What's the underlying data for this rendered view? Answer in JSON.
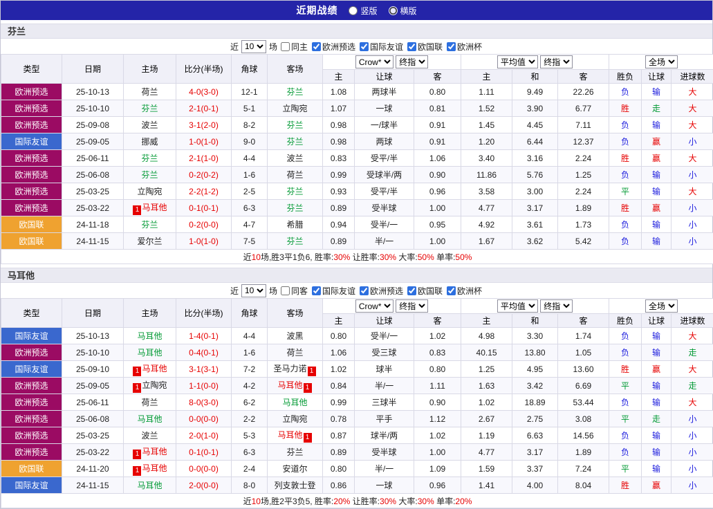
{
  "topbar": {
    "title": "近期战绩",
    "view_options": [
      {
        "label": "竖版",
        "selected": false
      },
      {
        "label": "横版",
        "selected": true
      }
    ]
  },
  "colors": {
    "topbar_bg": "#2424A8",
    "red": "#E60000",
    "blue": "#1C1CDD",
    "green": "#009933",
    "black": "#222222"
  },
  "type_colors": {
    "欧洲预选": "#9B0B63",
    "国际友谊": "#3A68CE",
    "欧国联": "#EFA230"
  },
  "table_headers": [
    "类型",
    "日期",
    "主场",
    "比分(半场)",
    "角球",
    "客场",
    "主",
    "让球",
    "客",
    "主",
    "和",
    "客",
    "胜负",
    "让球",
    "进球数"
  ],
  "sections": [
    {
      "title": "芬兰",
      "filter": {
        "near_label": "近",
        "count": "10",
        "games_label": "场",
        "same_side_label": "同主",
        "same_side_checked": false,
        "competitions": [
          {
            "label": "欧洲预选",
            "checked": true
          },
          {
            "label": "国际友谊",
            "checked": true
          },
          {
            "label": "欧国联",
            "checked": true
          },
          {
            "label": "欧洲杯",
            "checked": true
          }
        ]
      },
      "selects": {
        "odds_company": "Crow*",
        "odds_stage1": "终指",
        "average": "平均值",
        "odds_stage2": "终指",
        "scope": "全场"
      },
      "rows": [
        {
          "type": "欧洲预选",
          "date": "25-10-13",
          "home": {
            "name": "荷兰",
            "color": "black"
          },
          "score": "4-0(3-0)",
          "corner": "12-1",
          "away": {
            "name": "芬兰",
            "color": "green"
          },
          "odds": [
            "1.08",
            "两球半",
            "0.80"
          ],
          "avg": [
            "1.11",
            "9.49",
            "22.26"
          ],
          "results": [
            {
              "t": "负",
              "c": "blue"
            },
            {
              "t": "输",
              "c": "blue"
            },
            {
              "t": "大",
              "c": "red"
            }
          ]
        },
        {
          "type": "欧洲预选",
          "date": "25-10-10",
          "home": {
            "name": "芬兰",
            "color": "green"
          },
          "score": "2-1(0-1)",
          "corner": "5-1",
          "away": {
            "name": "立陶宛",
            "color": "black"
          },
          "odds": [
            "1.07",
            "一球",
            "0.81"
          ],
          "avg": [
            "1.52",
            "3.90",
            "6.77"
          ],
          "results": [
            {
              "t": "胜",
              "c": "red"
            },
            {
              "t": "走",
              "c": "green"
            },
            {
              "t": "大",
              "c": "red"
            }
          ]
        },
        {
          "type": "欧洲预选",
          "date": "25-09-08",
          "home": {
            "name": "波兰",
            "color": "black"
          },
          "score": "3-1(2-0)",
          "corner": "8-2",
          "away": {
            "name": "芬兰",
            "color": "green"
          },
          "odds": [
            "0.98",
            "一/球半",
            "0.91"
          ],
          "avg": [
            "1.45",
            "4.45",
            "7.11"
          ],
          "results": [
            {
              "t": "负",
              "c": "blue"
            },
            {
              "t": "输",
              "c": "blue"
            },
            {
              "t": "大",
              "c": "red"
            }
          ]
        },
        {
          "type": "国际友谊",
          "date": "25-09-05",
          "home": {
            "name": "挪威",
            "color": "black"
          },
          "score": "1-0(1-0)",
          "corner": "9-0",
          "away": {
            "name": "芬兰",
            "color": "green"
          },
          "odds": [
            "0.98",
            "两球",
            "0.91"
          ],
          "avg": [
            "1.20",
            "6.44",
            "12.37"
          ],
          "results": [
            {
              "t": "负",
              "c": "blue"
            },
            {
              "t": "赢",
              "c": "red"
            },
            {
              "t": "小",
              "c": "blue"
            }
          ]
        },
        {
          "type": "欧洲预选",
          "date": "25-06-11",
          "home": {
            "name": "芬兰",
            "color": "green"
          },
          "score": "2-1(1-0)",
          "corner": "4-4",
          "away": {
            "name": "波兰",
            "color": "black"
          },
          "odds": [
            "0.83",
            "受平/半",
            "1.06"
          ],
          "avg": [
            "3.40",
            "3.16",
            "2.24"
          ],
          "results": [
            {
              "t": "胜",
              "c": "red"
            },
            {
              "t": "赢",
              "c": "red"
            },
            {
              "t": "大",
              "c": "red"
            }
          ]
        },
        {
          "type": "欧洲预选",
          "date": "25-06-08",
          "home": {
            "name": "芬兰",
            "color": "green"
          },
          "score": "0-2(0-2)",
          "corner": "1-6",
          "away": {
            "name": "荷兰",
            "color": "black"
          },
          "odds": [
            "0.99",
            "受球半/两",
            "0.90"
          ],
          "avg": [
            "11.86",
            "5.76",
            "1.25"
          ],
          "results": [
            {
              "t": "负",
              "c": "blue"
            },
            {
              "t": "输",
              "c": "blue"
            },
            {
              "t": "小",
              "c": "blue"
            }
          ]
        },
        {
          "type": "欧洲预选",
          "date": "25-03-25",
          "home": {
            "name": "立陶宛",
            "color": "black"
          },
          "score": "2-2(1-2)",
          "corner": "2-5",
          "away": {
            "name": "芬兰",
            "color": "green"
          },
          "odds": [
            "0.93",
            "受平/半",
            "0.96"
          ],
          "avg": [
            "3.58",
            "3.00",
            "2.24"
          ],
          "results": [
            {
              "t": "平",
              "c": "green"
            },
            {
              "t": "输",
              "c": "blue"
            },
            {
              "t": "大",
              "c": "red"
            }
          ]
        },
        {
          "type": "欧洲预选",
          "date": "25-03-22",
          "home": {
            "name": "马耳他",
            "color": "red",
            "badge": "left"
          },
          "score": "0-1(0-1)",
          "corner": "6-3",
          "away": {
            "name": "芬兰",
            "color": "green"
          },
          "odds": [
            "0.89",
            "受半球",
            "1.00"
          ],
          "avg": [
            "4.77",
            "3.17",
            "1.89"
          ],
          "results": [
            {
              "t": "胜",
              "c": "red"
            },
            {
              "t": "赢",
              "c": "red"
            },
            {
              "t": "小",
              "c": "blue"
            }
          ]
        },
        {
          "type": "欧国联",
          "date": "24-11-18",
          "home": {
            "name": "芬兰",
            "color": "green"
          },
          "score": "0-2(0-0)",
          "corner": "4-7",
          "away": {
            "name": "希腊",
            "color": "black"
          },
          "odds": [
            "0.94",
            "受半/一",
            "0.95"
          ],
          "avg": [
            "4.92",
            "3.61",
            "1.73"
          ],
          "results": [
            {
              "t": "负",
              "c": "blue"
            },
            {
              "t": "输",
              "c": "blue"
            },
            {
              "t": "小",
              "c": "blue"
            }
          ]
        },
        {
          "type": "欧国联",
          "date": "24-11-15",
          "home": {
            "name": "爱尔兰",
            "color": "black"
          },
          "score": "1-0(1-0)",
          "corner": "7-5",
          "away": {
            "name": "芬兰",
            "color": "green"
          },
          "odds": [
            "0.89",
            "半/一",
            "1.00"
          ],
          "avg": [
            "1.67",
            "3.62",
            "5.42"
          ],
          "results": [
            {
              "t": "负",
              "c": "blue"
            },
            {
              "t": "输",
              "c": "blue"
            },
            {
              "t": "小",
              "c": "blue"
            }
          ]
        }
      ],
      "summary": {
        "prefix": "近",
        "count": "10",
        "record": "场,胜3平1负6, 胜率:",
        "win_rate": "30%",
        "handicap_label": " 让胜率:",
        "handicap_rate": "30%",
        "over_label": " 大率:",
        "over_rate": "50%",
        "odd_label": " 单率:",
        "odd_rate": "50%"
      }
    },
    {
      "title": "马耳他",
      "filter": {
        "near_label": "近",
        "count": "10",
        "games_label": "场",
        "same_side_label": "同客",
        "same_side_checked": false,
        "competitions": [
          {
            "label": "国际友谊",
            "checked": true
          },
          {
            "label": "欧洲预选",
            "checked": true
          },
          {
            "label": "欧国联",
            "checked": true
          },
          {
            "label": "欧洲杯",
            "checked": true
          }
        ]
      },
      "selects": {
        "odds_company": "Crow*",
        "odds_stage1": "终指",
        "average": "平均值",
        "odds_stage2": "终指",
        "scope": "全场"
      },
      "rows": [
        {
          "type": "国际友谊",
          "date": "25-10-13",
          "home": {
            "name": "马耳他",
            "color": "green"
          },
          "score": "1-4(0-1)",
          "corner": "4-4",
          "away": {
            "name": "波黑",
            "color": "black"
          },
          "odds": [
            "0.80",
            "受半/一",
            "1.02"
          ],
          "avg": [
            "4.98",
            "3.30",
            "1.74"
          ],
          "results": [
            {
              "t": "负",
              "c": "blue"
            },
            {
              "t": "输",
              "c": "blue"
            },
            {
              "t": "大",
              "c": "red"
            }
          ]
        },
        {
          "type": "欧洲预选",
          "date": "25-10-10",
          "home": {
            "name": "马耳他",
            "color": "green"
          },
          "score": "0-4(0-1)",
          "corner": "1-6",
          "away": {
            "name": "荷兰",
            "color": "black"
          },
          "odds": [
            "1.06",
            "受三球",
            "0.83"
          ],
          "avg": [
            "40.15",
            "13.80",
            "1.05"
          ],
          "results": [
            {
              "t": "负",
              "c": "blue"
            },
            {
              "t": "输",
              "c": "blue"
            },
            {
              "t": "走",
              "c": "green"
            }
          ]
        },
        {
          "type": "国际友谊",
          "date": "25-09-10",
          "home": {
            "name": "马耳他",
            "color": "red",
            "badge": "left"
          },
          "score": "3-1(3-1)",
          "corner": "7-2",
          "away": {
            "name": "圣马力诺",
            "color": "black",
            "badge": "right"
          },
          "odds": [
            "1.02",
            "球半",
            "0.80"
          ],
          "avg": [
            "1.25",
            "4.95",
            "13.60"
          ],
          "results": [
            {
              "t": "胜",
              "c": "red"
            },
            {
              "t": "赢",
              "c": "red"
            },
            {
              "t": "大",
              "c": "red"
            }
          ]
        },
        {
          "type": "欧洲预选",
          "date": "25-09-05",
          "home": {
            "name": "立陶宛",
            "color": "black",
            "badge": "left"
          },
          "score": "1-1(0-0)",
          "corner": "4-2",
          "away": {
            "name": "马耳他",
            "color": "red",
            "badge": "right"
          },
          "odds": [
            "0.84",
            "半/一",
            "1.11"
          ],
          "avg": [
            "1.63",
            "3.42",
            "6.69"
          ],
          "results": [
            {
              "t": "平",
              "c": "green"
            },
            {
              "t": "输",
              "c": "blue"
            },
            {
              "t": "走",
              "c": "green"
            }
          ]
        },
        {
          "type": "欧洲预选",
          "date": "25-06-11",
          "home": {
            "name": "荷兰",
            "color": "black"
          },
          "score": "8-0(3-0)",
          "corner": "6-2",
          "away": {
            "name": "马耳他",
            "color": "green"
          },
          "odds": [
            "0.99",
            "三球半",
            "0.90"
          ],
          "avg": [
            "1.02",
            "18.89",
            "53.44"
          ],
          "results": [
            {
              "t": "负",
              "c": "blue"
            },
            {
              "t": "输",
              "c": "blue"
            },
            {
              "t": "大",
              "c": "red"
            }
          ]
        },
        {
          "type": "欧洲预选",
          "date": "25-06-08",
          "home": {
            "name": "马耳他",
            "color": "green"
          },
          "score": "0-0(0-0)",
          "corner": "2-2",
          "away": {
            "name": "立陶宛",
            "color": "black"
          },
          "odds": [
            "0.78",
            "平手",
            "1.12"
          ],
          "avg": [
            "2.67",
            "2.75",
            "3.08"
          ],
          "results": [
            {
              "t": "平",
              "c": "green"
            },
            {
              "t": "走",
              "c": "green"
            },
            {
              "t": "小",
              "c": "blue"
            }
          ]
        },
        {
          "type": "欧洲预选",
          "date": "25-03-25",
          "home": {
            "name": "波兰",
            "color": "black"
          },
          "score": "2-0(1-0)",
          "corner": "5-3",
          "away": {
            "name": "马耳他",
            "color": "red",
            "badge": "right"
          },
          "odds": [
            "0.87",
            "球半/两",
            "1.02"
          ],
          "avg": [
            "1.19",
            "6.63",
            "14.56"
          ],
          "results": [
            {
              "t": "负",
              "c": "blue"
            },
            {
              "t": "输",
              "c": "blue"
            },
            {
              "t": "小",
              "c": "blue"
            }
          ]
        },
        {
          "type": "欧洲预选",
          "date": "25-03-22",
          "home": {
            "name": "马耳他",
            "color": "red",
            "badge": "left"
          },
          "score": "0-1(0-1)",
          "corner": "6-3",
          "away": {
            "name": "芬兰",
            "color": "black"
          },
          "odds": [
            "0.89",
            "受半球",
            "1.00"
          ],
          "avg": [
            "4.77",
            "3.17",
            "1.89"
          ],
          "results": [
            {
              "t": "负",
              "c": "blue"
            },
            {
              "t": "输",
              "c": "blue"
            },
            {
              "t": "小",
              "c": "blue"
            }
          ]
        },
        {
          "type": "欧国联",
          "date": "24-11-20",
          "home": {
            "name": "马耳他",
            "color": "red",
            "badge": "left"
          },
          "score": "0-0(0-0)",
          "corner": "2-4",
          "away": {
            "name": "安道尔",
            "color": "black"
          },
          "odds": [
            "0.80",
            "半/一",
            "1.09"
          ],
          "avg": [
            "1.59",
            "3.37",
            "7.24"
          ],
          "results": [
            {
              "t": "平",
              "c": "green"
            },
            {
              "t": "输",
              "c": "blue"
            },
            {
              "t": "小",
              "c": "blue"
            }
          ]
        },
        {
          "type": "国际友谊",
          "date": "24-11-15",
          "home": {
            "name": "马耳他",
            "color": "green"
          },
          "score": "2-0(0-0)",
          "corner": "8-0",
          "away": {
            "name": "列支敦士登",
            "color": "black"
          },
          "odds": [
            "0.86",
            "一球",
            "0.96"
          ],
          "avg": [
            "1.41",
            "4.00",
            "8.04"
          ],
          "results": [
            {
              "t": "胜",
              "c": "red"
            },
            {
              "t": "赢",
              "c": "red"
            },
            {
              "t": "小",
              "c": "blue"
            }
          ]
        }
      ],
      "summary": {
        "prefix": "近",
        "count": "10",
        "record": "场,胜2平3负5, 胜率:",
        "win_rate": "20%",
        "handicap_label": " 让胜率:",
        "handicap_rate": "30%",
        "over_label": " 大率:",
        "over_rate": "30%",
        "odd_label": " 单率:",
        "odd_rate": "20%"
      }
    }
  ]
}
